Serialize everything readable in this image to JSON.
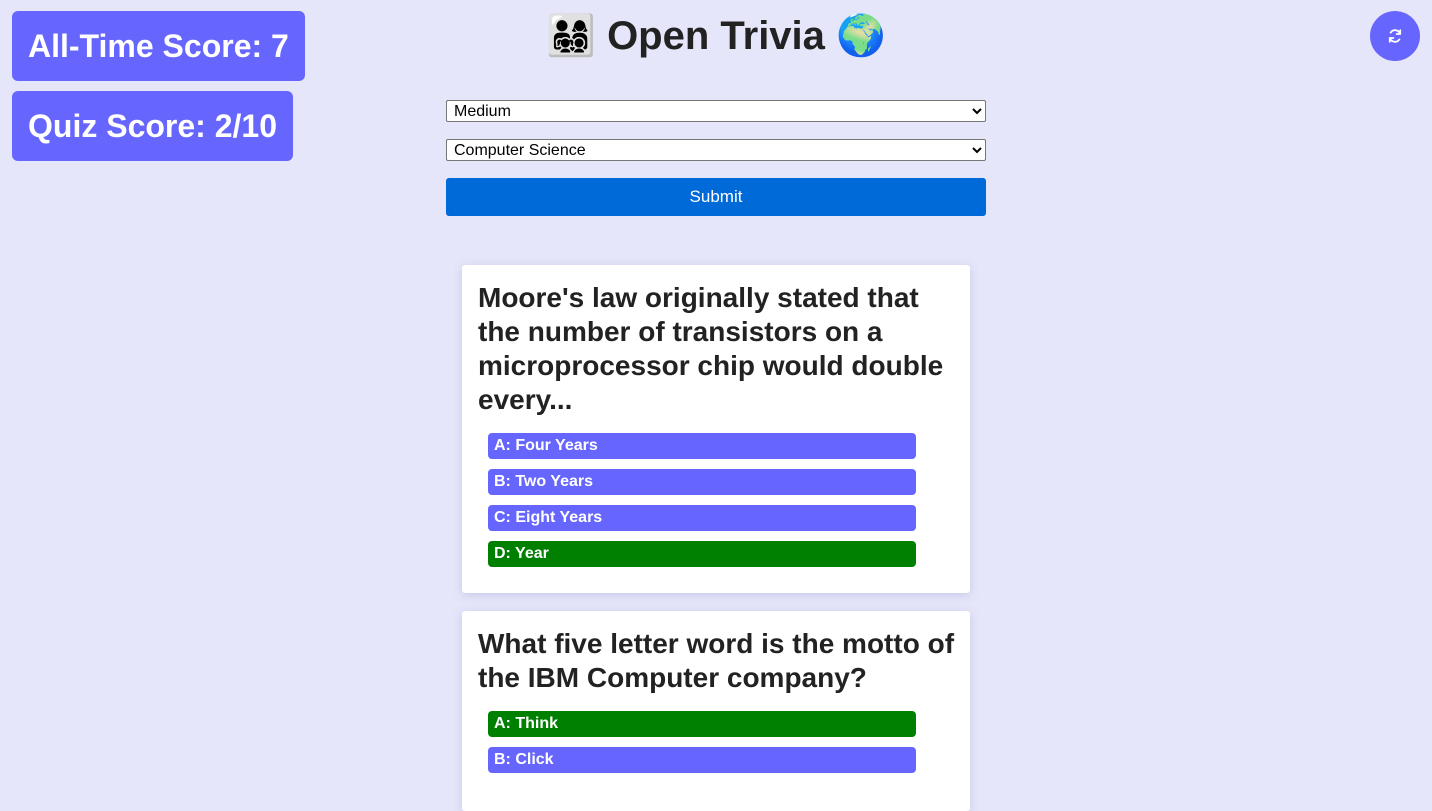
{
  "scores": {
    "all_time": "All-Time Score: 7",
    "quiz": "Quiz Score: 2/10"
  },
  "header": {
    "emoji_left": "👨‍👩‍👧‍👦",
    "title": "Open Trivia",
    "emoji_right": "🌍"
  },
  "controls": {
    "difficulty": "Medium",
    "category": "Computer Science",
    "submit_label": "Submit"
  },
  "colors": {
    "background": "#e6e6fa",
    "accent": "#6666ff",
    "correct": "#008000",
    "submit": "#006ad8"
  },
  "questions": [
    {
      "text": "Moore's law originally stated that the number of transistors on a microprocessor chip would double every...",
      "answers": [
        {
          "label": "A: Four Years",
          "correct": false
        },
        {
          "label": "B: Two Years",
          "correct": false
        },
        {
          "label": "C: Eight Years",
          "correct": false
        },
        {
          "label": "D: Year",
          "correct": true
        }
      ]
    },
    {
      "text": "What five letter word is the motto of the IBM Computer company?",
      "answers": [
        {
          "label": "A: Think",
          "correct": true
        },
        {
          "label": "B: Click",
          "correct": false
        }
      ]
    }
  ],
  "icons": {
    "refresh": "refresh-icon"
  }
}
